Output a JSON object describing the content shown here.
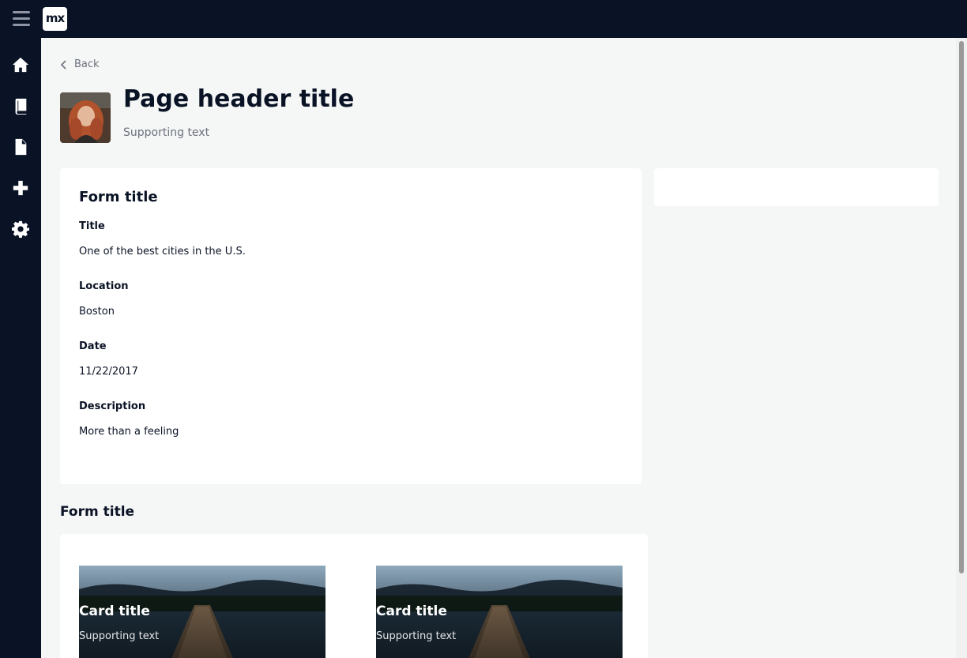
{
  "app": {
    "logo_text": "mx"
  },
  "nav": {
    "items": [
      {
        "icon": "home-icon"
      },
      {
        "icon": "book-icon"
      },
      {
        "icon": "file-icon"
      },
      {
        "icon": "plus-icon"
      },
      {
        "icon": "gear-icon"
      }
    ]
  },
  "header": {
    "back_label": "Back",
    "title": "Page header title",
    "supporting": "Supporting text"
  },
  "form": {
    "title": "Form title",
    "fields": [
      {
        "label": "Title",
        "value": "One of the best cities in the U.S."
      },
      {
        "label": "Location",
        "value": "Boston"
      },
      {
        "label": "Date",
        "value": "11/22/2017"
      },
      {
        "label": "Description",
        "value": "More than a feeling"
      }
    ]
  },
  "section": {
    "title": "Form title",
    "cards": [
      {
        "title": "Card title",
        "supporting": "Supporting text"
      },
      {
        "title": "Card title",
        "supporting": "Supporting text"
      }
    ]
  },
  "colors": {
    "nav_bg": "#0a1325",
    "page_bg": "#f5f6f6",
    "muted_text": "#6c717e"
  }
}
